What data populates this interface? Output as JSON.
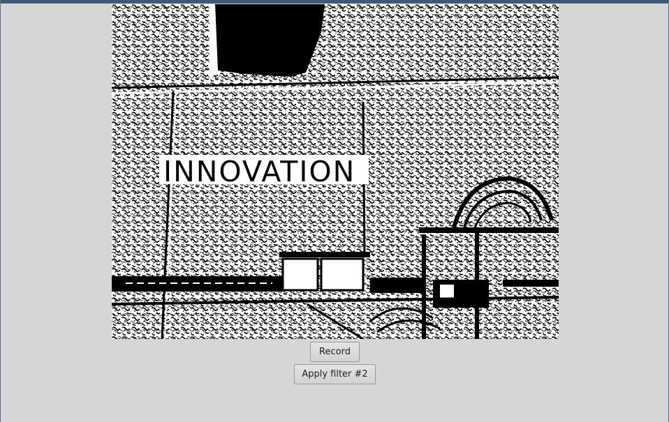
{
  "window": {
    "accent_color": "#3f5a78",
    "background_color": "#d6d6d6"
  },
  "video": {
    "description_icon": "camera-feed-filtered",
    "sign_text": "INNOVATION"
  },
  "controls": {
    "record_label": "Record",
    "filter_label": "Apply filter #2"
  }
}
